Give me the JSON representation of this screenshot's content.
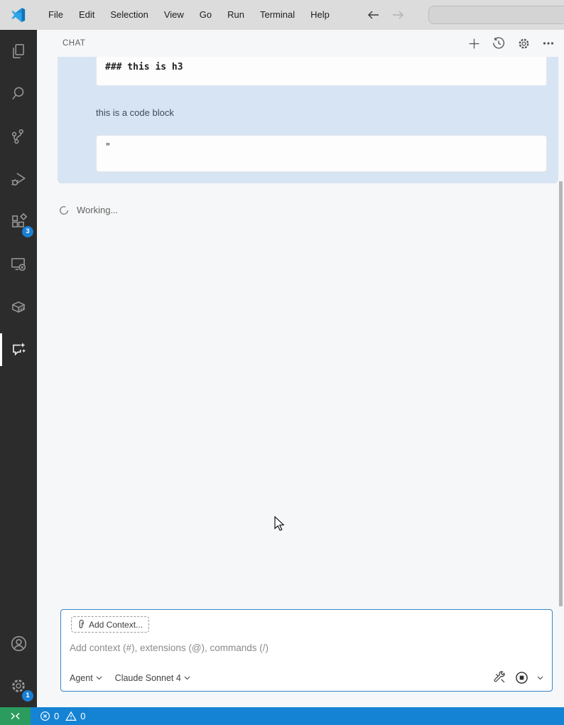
{
  "titlebar": {
    "menus": [
      "File",
      "Edit",
      "Selection",
      "View",
      "Go",
      "Run",
      "Terminal",
      "Help"
    ]
  },
  "activity_bar": {
    "items": [
      {
        "label": "explorer"
      },
      {
        "label": "search"
      },
      {
        "label": "source-control"
      },
      {
        "label": "run-and-debug"
      },
      {
        "label": "extensions",
        "badge": "3"
      },
      {
        "label": "remote-explorer"
      },
      {
        "label": "containers"
      },
      {
        "label": "chat",
        "active": true
      }
    ],
    "bottom_items": [
      {
        "label": "accounts"
      },
      {
        "label": "manage",
        "badge": "1"
      }
    ]
  },
  "chat": {
    "header": {
      "title": "CHAT"
    },
    "request": {
      "code_block_1": "### this is h3",
      "paragraph": "this is a code block",
      "code_block_2": "\""
    },
    "working_label": "Working...",
    "input": {
      "add_context_label": "Add Context...",
      "placeholder": "Add context (#), extensions (@), commands (/)",
      "mode": "Agent",
      "model": "Claude Sonnet 4"
    }
  },
  "status_bar": {
    "errors": "0",
    "warnings": "0"
  },
  "colors": {
    "titlebar_bg": "#dcdcdc",
    "activitybar_bg": "#2c2c2c",
    "panel_bg": "#f6f7f8",
    "request_bubble_bg": "#d7e4f3",
    "codeblock_bg": "#fdfdfd",
    "focus_border": "#3584c9",
    "badge_bg": "#1a7fd4",
    "statusbar_bg": "#1583d3",
    "remote_bg": "#2b9c5e"
  }
}
